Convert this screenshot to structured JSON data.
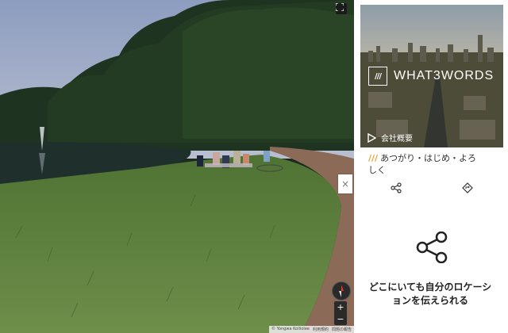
{
  "panorama": {
    "attribution": "© Yongwa Kolliolee",
    "terms_label": "利用規約",
    "report_label": "問題の報告",
    "zoom_in": "+",
    "zoom_out": "−"
  },
  "panel": {
    "brand_name": "WHAT3WORDS",
    "brand_logo_text": "///",
    "about_label": "会社概要",
    "tagline_slashes": "///",
    "tagline": "あつがり・はじめ・よろしく",
    "message": "どこにいても自分のロケーションを伝えられる",
    "close_label": "×"
  },
  "colors": {
    "accent": "#e8a23a",
    "sky": "#9aa9c6",
    "grass": "#5d7f3e"
  },
  "icons": [
    "fullscreen-icon",
    "compass-icon",
    "play-icon",
    "share-icon",
    "directions-icon"
  ]
}
